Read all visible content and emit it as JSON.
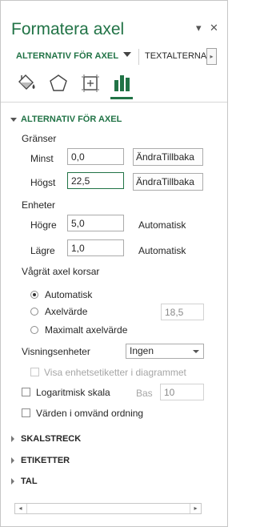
{
  "pane": {
    "title": "Formatera axel",
    "menu_glyph": "▾",
    "close_glyph": "✕"
  },
  "tabs": {
    "active": "ALTERNATIV FÖR AXEL",
    "other": "TEXTALTERNA",
    "scroll_glyph": "▸"
  },
  "icons": [
    "fill-line-icon",
    "effects-icon",
    "size-properties-icon",
    "axis-options-icon"
  ],
  "accent_color": "#217346",
  "sections": {
    "axis_options": {
      "label": "ALTERNATIV FÖR AXEL",
      "bounds": {
        "heading": "Gränser",
        "min_label": "Minst",
        "min_value": "0,0",
        "max_label": "Högst",
        "max_value": "22,5",
        "min_button": "ÄndraTillbaka",
        "max_button": "ÄndraTillbaka"
      },
      "units": {
        "heading": "Enheter",
        "major_label": "Högre",
        "major_value": "5,0",
        "major_auto": "Automatisk",
        "minor_label": "Lägre",
        "minor_value": "1,0",
        "minor_auto": "Automatisk"
      },
      "crosses": {
        "heading": "Vågrät axel korsar",
        "opt_auto": "Automatisk",
        "opt_value": "Axelvärde",
        "opt_value_input": "18,5",
        "opt_max": "Maximalt axelvärde",
        "selected": "Automatisk"
      },
      "display_units": {
        "label": "Visningsenheter",
        "value": "Ingen",
        "show_label": "Visa enhetsetiketter i diagrammet"
      },
      "log_scale": {
        "label": "Logaritmisk skala",
        "base_label": "Bas",
        "base_value": "10"
      },
      "reverse": {
        "label": "Värden i omvänd ordning"
      }
    },
    "tick_marks": "SKALSTRECK",
    "labels": "ETIKETTER",
    "number": "TAL"
  },
  "scrollbar": {
    "left_glyph": "◂",
    "right_glyph": "▸"
  }
}
